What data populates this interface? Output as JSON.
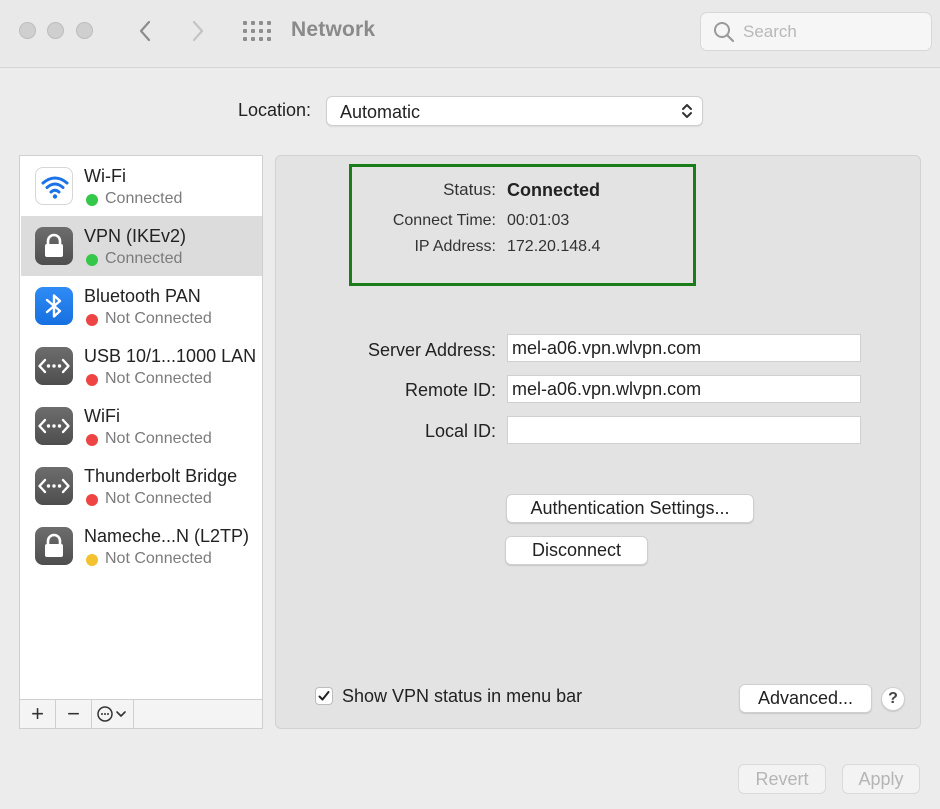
{
  "window": {
    "title": "Network"
  },
  "toolbar": {
    "back_icon": "chevron-left-icon",
    "forward_icon": "chevron-right-icon",
    "grid_icon": "show-all-grid-icon",
    "search": {
      "placeholder": "Search",
      "value": ""
    }
  },
  "location": {
    "label": "Location:",
    "value": "Automatic"
  },
  "sidebar": {
    "items": [
      {
        "name": "Wi-Fi",
        "status": "Connected",
        "status_color": "#34c749",
        "icon": "wifi-icon"
      },
      {
        "name": "VPN (IKEv2)",
        "status": "Connected",
        "status_color": "#34c749",
        "icon": "lock-icon",
        "selected": true
      },
      {
        "name": "Bluetooth PAN",
        "status": "Not Connected",
        "status_color": "#ee4444",
        "icon": "bluetooth-icon"
      },
      {
        "name": "USB 10/1...1000 LAN",
        "status": "Not Connected",
        "status_color": "#ee4444",
        "icon": "ethernet-icon"
      },
      {
        "name": "WiFi",
        "status": "Not Connected",
        "status_color": "#ee4444",
        "icon": "ethernet-icon"
      },
      {
        "name": "Thunderbolt Bridge",
        "status": "Not Connected",
        "status_color": "#ee4444",
        "icon": "ethernet-icon"
      },
      {
        "name": "Nameche...N (L2TP)",
        "status": "Not Connected",
        "status_color": "#f4c12f",
        "icon": "lock-icon"
      }
    ],
    "footer": {
      "add": "+",
      "remove": "−",
      "action_icon": "action-menu-icon"
    }
  },
  "detail": {
    "status": {
      "status_label": "Status:",
      "status_value": "Connected",
      "connect_time_label": "Connect Time:",
      "connect_time_value": "00:01:03",
      "ip_label": "IP Address:",
      "ip_value": "172.20.148.4",
      "highlight_color": "#1a7d1a"
    },
    "server_address": {
      "label": "Server Address:",
      "value": "mel-a06.vpn.wlvpn.com"
    },
    "remote_id": {
      "label": "Remote ID:",
      "value": "mel-a06.vpn.wlvpn.com"
    },
    "local_id": {
      "label": "Local ID:",
      "value": ""
    },
    "auth_button": "Authentication Settings...",
    "disconnect_button": "Disconnect",
    "show_vpn_status": {
      "label": "Show VPN status in menu bar",
      "checked": true
    },
    "advanced_button": "Advanced...",
    "help_button": "?"
  },
  "footer": {
    "revert": "Revert",
    "apply": "Apply"
  }
}
